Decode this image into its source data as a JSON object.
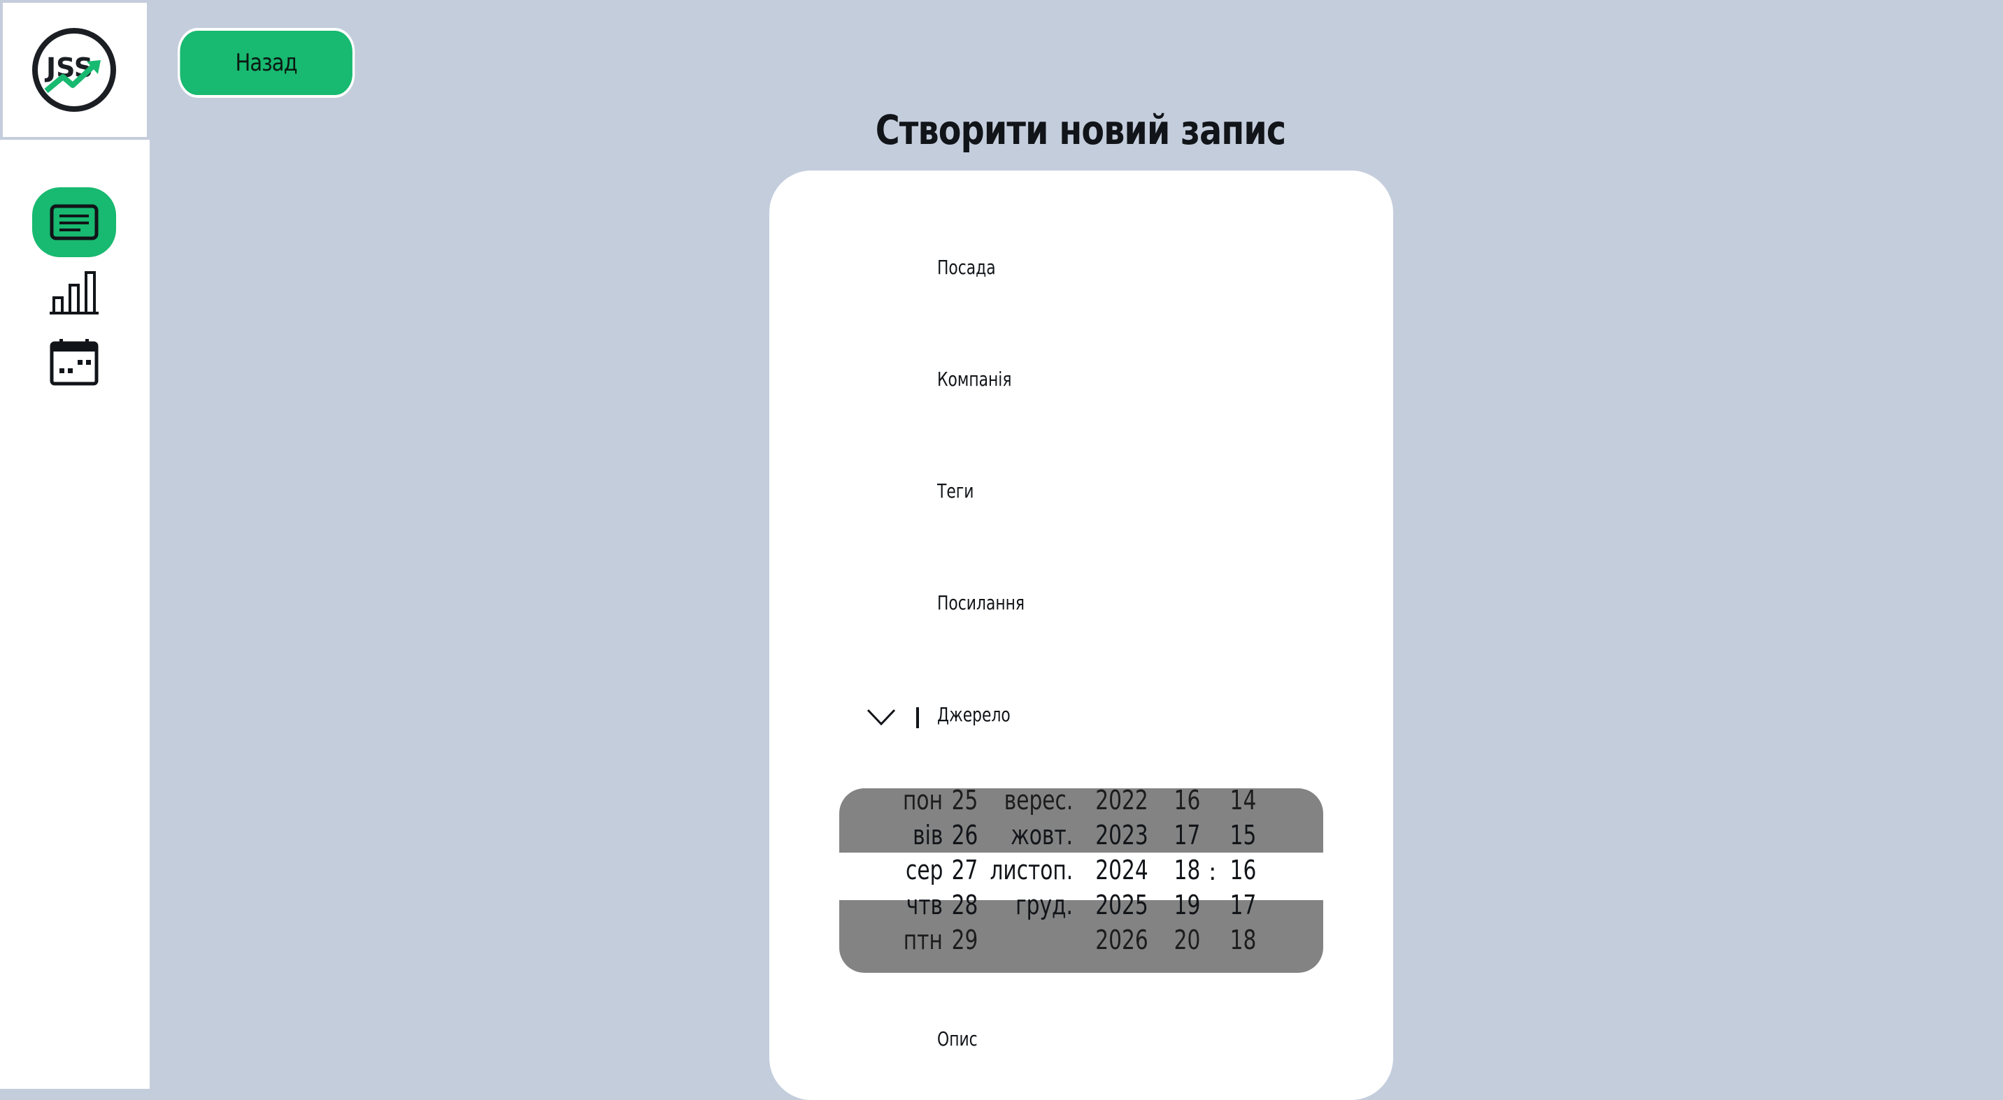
{
  "sidebar": {
    "logo_text": "JSS",
    "nav": [
      {
        "icon": "records-icon",
        "active": true
      },
      {
        "icon": "stats-chart-icon",
        "active": false
      },
      {
        "icon": "calendar-icon",
        "active": false
      }
    ]
  },
  "header": {
    "back_label": "Назад",
    "title": "Створити новий запис"
  },
  "form": {
    "fields": {
      "position": "Посада",
      "company": "Компанія",
      "tags": "Теги",
      "link": "Посилання",
      "source": "Джерело",
      "description": "Опис"
    },
    "datetime_picker": {
      "weekdays": [
        "пон",
        "вів",
        "сер",
        "чтв",
        "птн"
      ],
      "days": [
        "25",
        "26",
        "27",
        "28",
        "29"
      ],
      "months": [
        "верес.",
        "жовт.",
        "листоп.",
        "груд.",
        ""
      ],
      "years": [
        "2022",
        "2023",
        "2024",
        "2025",
        "2026"
      ],
      "hours": [
        "16",
        "17",
        "18",
        "19",
        "20"
      ],
      "minutes": [
        "14",
        "15",
        "16",
        "17",
        "18"
      ],
      "separator": ":",
      "selected": {
        "weekday": "сер",
        "day": "27",
        "month": "листоп.",
        "year": "2024",
        "hour": "18",
        "minute": "16"
      }
    }
  },
  "colors": {
    "accent": "#18b970",
    "background": "#c4cddc",
    "picker_bg": "#838383"
  }
}
